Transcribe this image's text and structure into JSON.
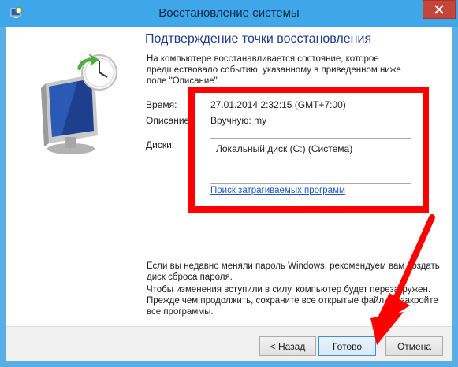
{
  "window": {
    "title": "Восстановление системы"
  },
  "page": {
    "heading": "Подтверждение точки восстановления",
    "intro": "На компьютере восстанавливается состояние, которое предшествовало событию, указанному в приведенном ниже поле \"Описание\".",
    "time_label": "Время:",
    "time_value": "27.01.2014 2:32:15 (GMT+7:00)",
    "description_label": "Описание:",
    "description_value": "Вручную: my",
    "disks_label": "Диски:",
    "disks_value": "Локальный диск (C:) (Система)",
    "affected_programs_link": "Поиск затрагиваемых программ",
    "password_warning": "Если вы недавно меняли пароль Windows, рекомендуем вам создать диск сброса пароля.",
    "restart_warning": "Чтобы изменения вступили в силу, компьютер будет перезагружен. Прежде чем продолжить, сохраните все открытые файлы и закройте все программы."
  },
  "buttons": {
    "back": "< Назад",
    "finish": "Готово",
    "cancel": "Отмена"
  },
  "colors": {
    "titlebar": "#3fa6ea",
    "close": "#c7443a",
    "highlight": "#ff0000",
    "heading": "#1c3d8a",
    "link": "#1a56c4"
  },
  "icons": {
    "title": "system-restore-icon",
    "close": "close-icon",
    "art": "system-restore-monitor-icon"
  }
}
